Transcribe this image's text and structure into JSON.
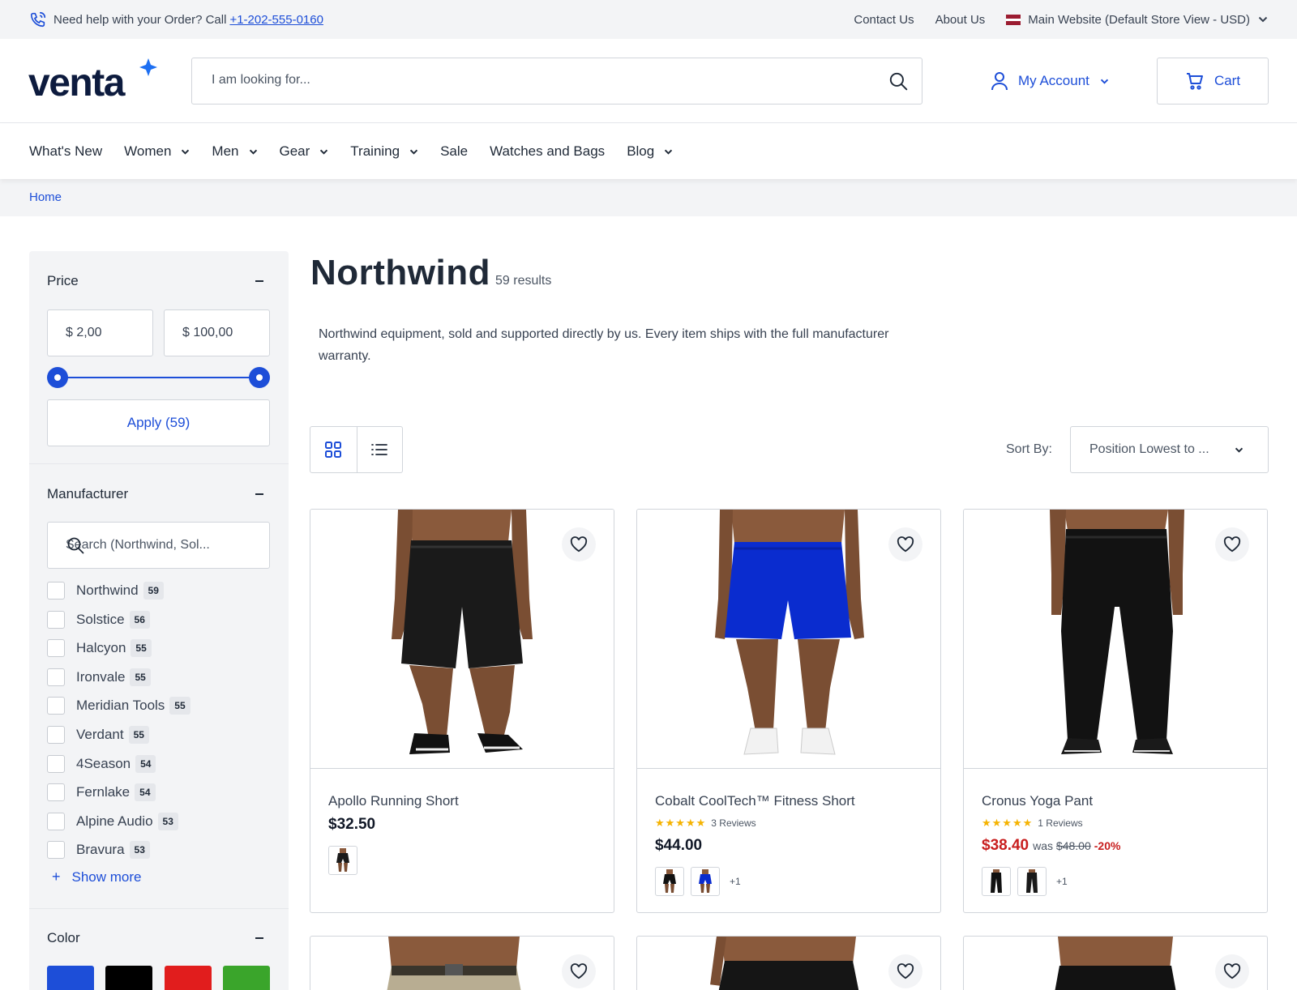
{
  "topbar": {
    "help_text": "Need help with your Order? Call",
    "phone": "+1-202-555-0160",
    "links": [
      "Contact Us",
      "About Us"
    ],
    "store_view": "Main Website (Default Store View - USD)"
  },
  "header": {
    "logo_text": "venta",
    "search_placeholder": "I am looking for...",
    "account_label": "My Account",
    "cart_label": "Cart"
  },
  "nav": {
    "items": [
      {
        "label": "What's New",
        "has_dropdown": false
      },
      {
        "label": "Women",
        "has_dropdown": true
      },
      {
        "label": "Men",
        "has_dropdown": true
      },
      {
        "label": "Gear",
        "has_dropdown": true
      },
      {
        "label": "Training",
        "has_dropdown": true
      },
      {
        "label": "Sale",
        "has_dropdown": false
      },
      {
        "label": "Watches and Bags",
        "has_dropdown": false
      },
      {
        "label": "Blog",
        "has_dropdown": true
      }
    ]
  },
  "breadcrumb": {
    "home": "Home"
  },
  "filters": {
    "price": {
      "title": "Price",
      "min": "$ 2,00",
      "max": "$ 100,00",
      "apply_label": "Apply (59)"
    },
    "manufacturer": {
      "title": "Manufacturer",
      "search_placeholder": "Search (Northwind, Sol...",
      "options": [
        {
          "label": "Northwind",
          "count": "59"
        },
        {
          "label": "Solstice",
          "count": "56"
        },
        {
          "label": "Halcyon",
          "count": "55"
        },
        {
          "label": "Ironvale",
          "count": "55"
        },
        {
          "label": "Meridian Tools",
          "count": "55"
        },
        {
          "label": "Verdant",
          "count": "55"
        },
        {
          "label": "4Season",
          "count": "54"
        },
        {
          "label": "Fernlake",
          "count": "54"
        },
        {
          "label": "Alpine Audio",
          "count": "53"
        },
        {
          "label": "Bravura",
          "count": "53"
        }
      ],
      "show_more": "Show more"
    },
    "color": {
      "title": "Color",
      "swatches": [
        "#1d4ed8",
        "#000000",
        "#e11d1d",
        "#3aa52b"
      ]
    }
  },
  "category": {
    "title": "Northwind",
    "results": "59 results",
    "description": "Northwind equipment, sold and supported directly by us. Every item ships with the full manufacturer warranty.",
    "sort_label": "Sort By:",
    "sort_value": "Position Lowest to ..."
  },
  "products": [
    {
      "name": "Apollo Running Short",
      "price": "$32.50",
      "reviews": "",
      "was": "",
      "discount": "",
      "more": "",
      "colors": [
        "#2a2a2a",
        "#111111"
      ]
    },
    {
      "name": "Cobalt CoolTech™ Fitness Short",
      "price": "$44.00",
      "reviews": "3 Reviews",
      "was": "",
      "discount": "",
      "more": "+1",
      "colors": [
        "#0a2ccf",
        "#111111"
      ]
    },
    {
      "name": "Cronus Yoga Pant",
      "price": "$38.40",
      "reviews": "1 Reviews",
      "was_prefix": "was",
      "was": "$48.00",
      "discount": "-20%",
      "more": "+1",
      "colors": [
        "#111111",
        "#111111"
      ]
    }
  ]
}
